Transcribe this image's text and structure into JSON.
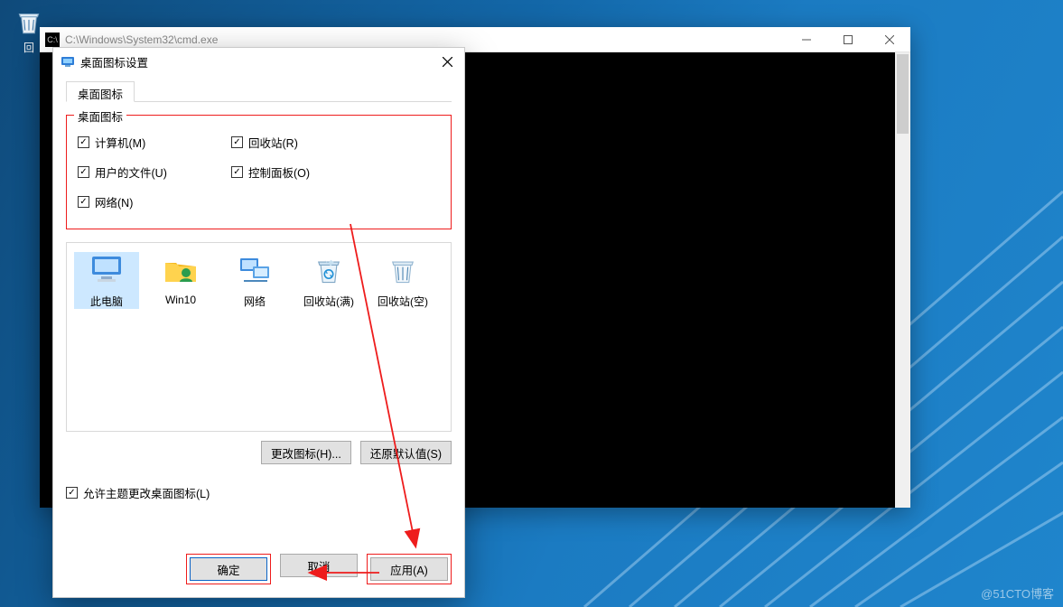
{
  "desktop": {
    "recycle_label": "回"
  },
  "cmd": {
    "title": "C:\\Windows\\System32\\cmd.exe"
  },
  "dialog": {
    "title": "桌面图标设置",
    "tab_label": "桌面图标",
    "group_label": "桌面图标",
    "checks": {
      "computer": "计算机(M)",
      "userfiles": "用户的文件(U)",
      "network": "网络(N)",
      "recycle": "回收站(R)",
      "cpanel": "控制面板(O)"
    },
    "icons": {
      "thispc": "此电脑",
      "user": "Win10",
      "net": "网络",
      "bin_full": "回收站(满)",
      "bin_empty": "回收站(空)"
    },
    "btn_change": "更改图标(H)...",
    "btn_restore": "还原默认值(S)",
    "allow_theme": "允许主题更改桌面图标(L)",
    "ok": "确定",
    "cancel": "取消",
    "apply": "应用(A)"
  },
  "watermark": "@51CTO博客"
}
